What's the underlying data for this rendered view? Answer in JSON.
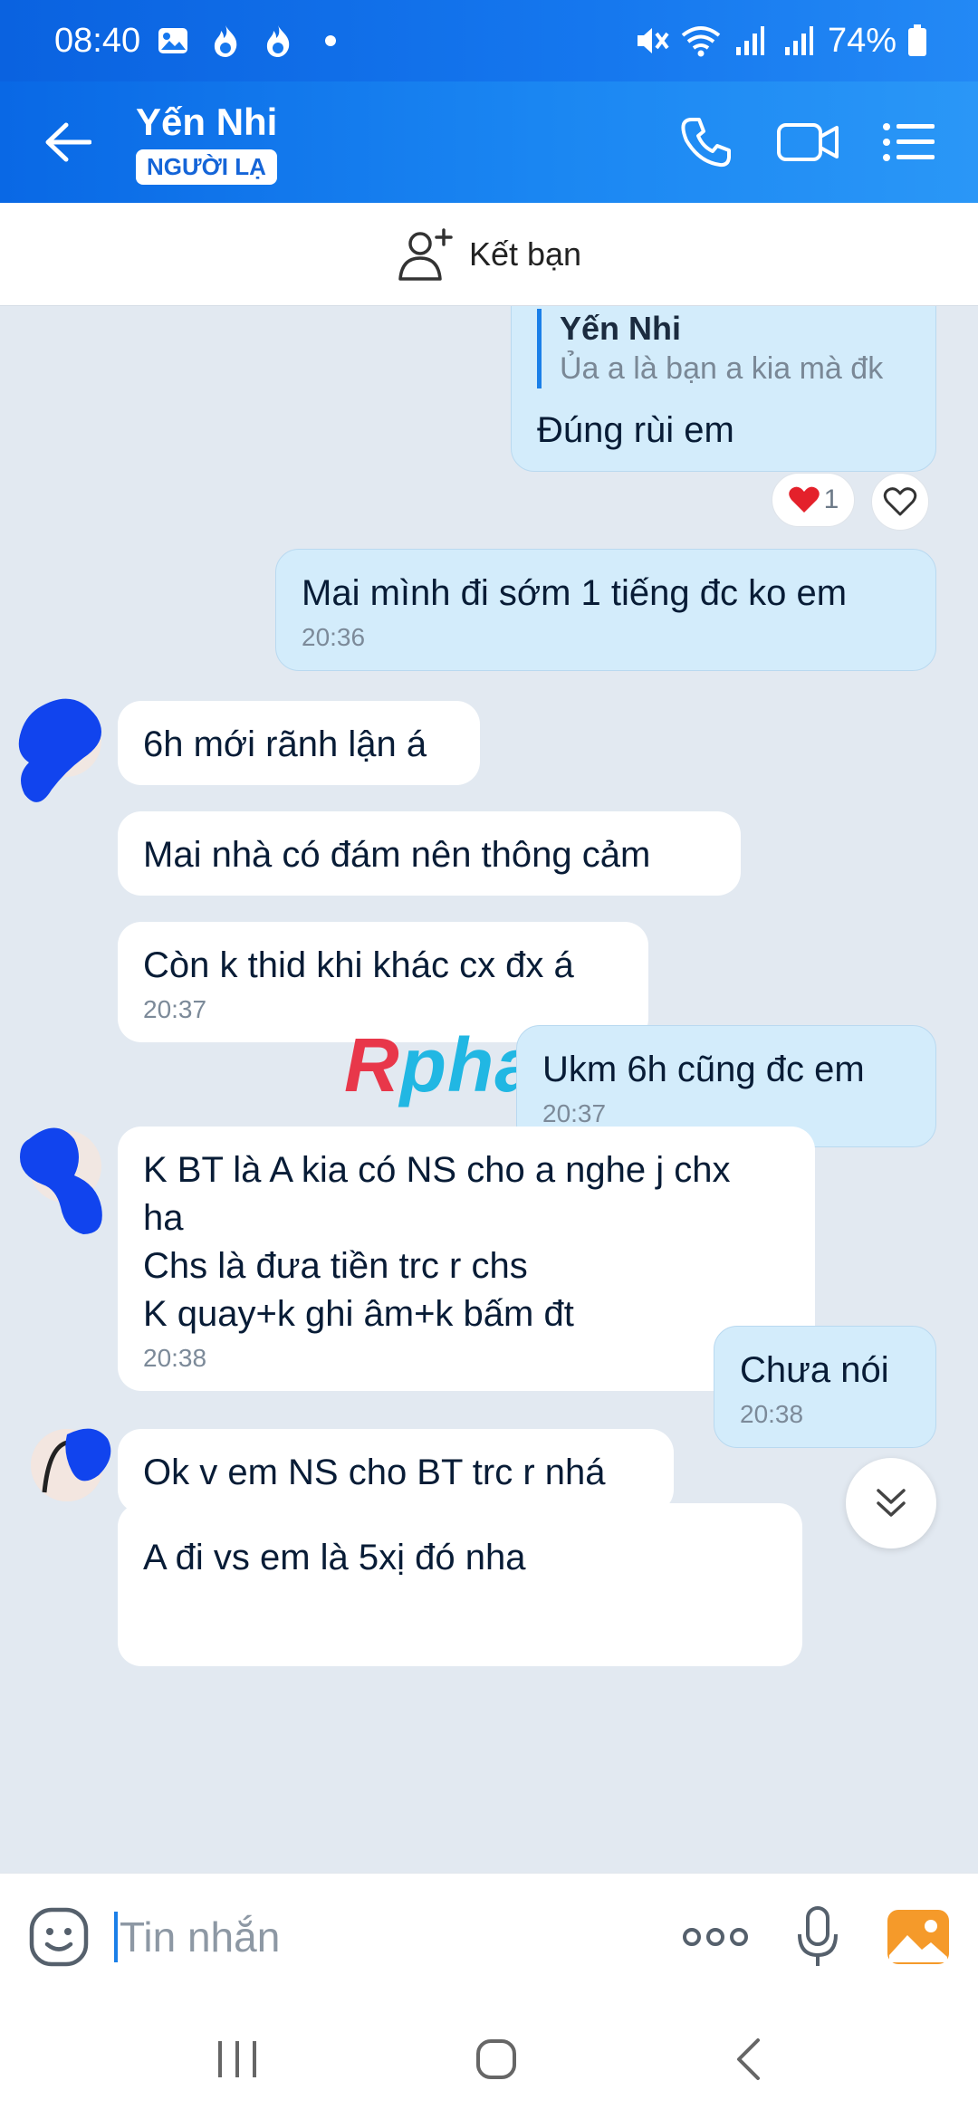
{
  "status_bar": {
    "time": "08:40",
    "battery": "74%",
    "icons_left": [
      "image-icon",
      "fire-icon",
      "fire-icon",
      "dot-icon"
    ],
    "icons_right": [
      "mute-icon",
      "wifi-icon",
      "signal-icon",
      "signal-icon",
      "battery-icon"
    ]
  },
  "header": {
    "contact_name": "Yến Nhi",
    "badge": "NGƯỜI LẠ",
    "actions": [
      "phone-icon",
      "video-call-icon",
      "menu-icon"
    ]
  },
  "add_friend": {
    "label": "Kết bạn"
  },
  "messages": [
    {
      "dir": "out",
      "quote_name": "Yến Nhi",
      "quote_text": "Ủa a là bạn a kia mà đk",
      "lines": [
        "Đúng rùi em"
      ],
      "reaction_count": "1"
    },
    {
      "dir": "out",
      "lines": [
        "Mai mình đi sớm 1 tiếng đc ko em"
      ],
      "time": "20:36"
    },
    {
      "dir": "in",
      "lines": [
        "6h mới rãnh lận á"
      ]
    },
    {
      "dir": "in",
      "lines": [
        "Mai nhà có đám nên thông cảm"
      ]
    },
    {
      "dir": "in",
      "lines": [
        "Còn k thid khi khác cx đx á"
      ],
      "time": "20:37"
    },
    {
      "dir": "out",
      "lines": [
        "Ukm 6h cũng đc em"
      ],
      "time": "20:37"
    },
    {
      "dir": "in",
      "lines": [
        "K BT là A kia có NS cho a nghe j chx",
        "ha",
        "Chs là đưa tiền trc r chs",
        "K quay+k ghi âm+k bấm đt"
      ],
      "time": "20:38"
    },
    {
      "dir": "out",
      "lines": [
        "Chưa nói"
      ],
      "time": "20:38"
    },
    {
      "dir": "in",
      "lines": [
        "Ok v em NS cho BT trc r nhá"
      ]
    },
    {
      "dir": "in",
      "lines": [
        "A đi vs em là 5xị đó nha"
      ]
    }
  ],
  "watermark": {
    "first": "R",
    "rest": "phang"
  },
  "input": {
    "placeholder": "Tin nhắn"
  },
  "colors": {
    "accent": "#1a7fe8",
    "outgoing_bubble": "#d3ecfb",
    "background": "#e2e9f1"
  }
}
